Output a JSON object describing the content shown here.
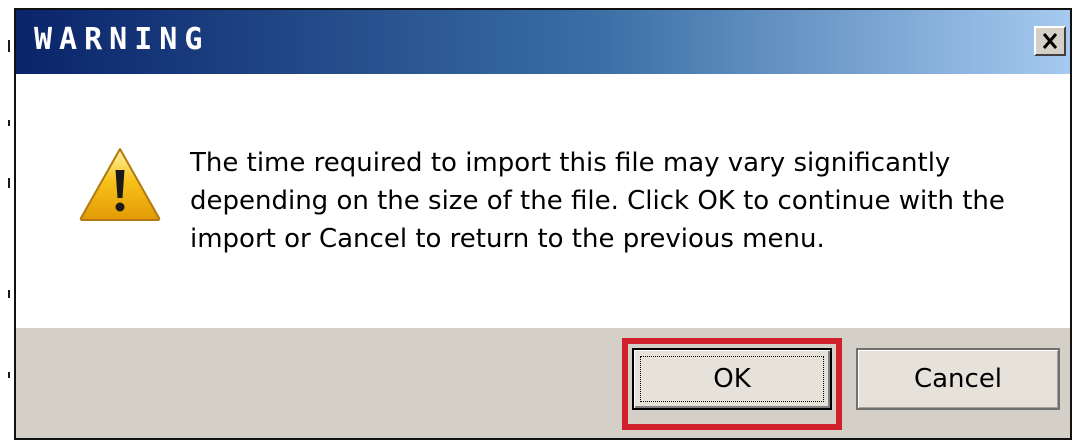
{
  "dialog": {
    "title": "WARNING",
    "message_lines": [
      "The time required to import this file may vary significantly",
      "depending on the size of the file. Click OK to continue with the",
      "import or Cancel to return to the previous menu."
    ],
    "buttons": {
      "ok": "OK",
      "cancel": "Cancel"
    },
    "icon": "warning-icon",
    "close_icon": "close-icon"
  },
  "colors": {
    "title_gradient_start": "#0a246a",
    "title_gradient_end": "#a6caf0",
    "footer_background": "#d4d0c8",
    "highlight_border": "#d0202a",
    "warning_yellow": "#f6c21a"
  }
}
